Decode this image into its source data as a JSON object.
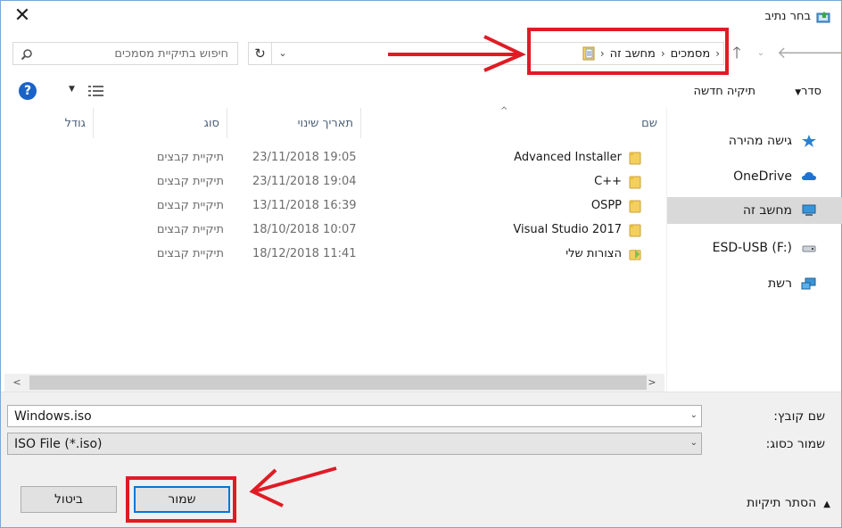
{
  "window": {
    "title": "בחר נתיב"
  },
  "address": {
    "crumbs": [
      "מחשב זה",
      "מסמכים"
    ]
  },
  "search": {
    "placeholder": "חיפוש בתיקיית מסמכים"
  },
  "toolbar": {
    "organize": "סדר",
    "new_folder": "תיקיה חדשה"
  },
  "navpane": {
    "items": [
      {
        "label": "גישה מהירה",
        "icon": "star-icon"
      },
      {
        "label": "OneDrive",
        "icon": "cloud-icon"
      },
      {
        "label": "מחשב זה",
        "icon": "computer-icon",
        "selected": true
      },
      {
        "label": "ESD-USB (F:)",
        "icon": "usb-drive-icon"
      },
      {
        "label": "רשת",
        "icon": "network-icon"
      }
    ]
  },
  "filelist": {
    "columns": {
      "name": "שם",
      "modified": "תאריך שינוי",
      "type": "סוג",
      "size": "גודל"
    },
    "rows": [
      {
        "name": "Advanced Installer",
        "modified": "23/11/2018 19:05",
        "type": "תיקיית קבצים"
      },
      {
        "name": "C++",
        "modified": "23/11/2018 19:04",
        "type": "תיקיית קבצים"
      },
      {
        "name": "OSPP",
        "modified": "13/11/2018 16:39",
        "type": "תיקיית קבצים"
      },
      {
        "name": "Visual Studio 2017",
        "modified": "18/10/2018 10:07",
        "type": "תיקיית קבצים"
      },
      {
        "name": "הצורות שלי",
        "modified": "18/12/2018 11:41",
        "type": "תיקיית קבצים"
      }
    ]
  },
  "form": {
    "filename_label": "שם קובץ:",
    "filename_value": "Windows.iso",
    "filetype_label": "שמור כסוג:",
    "filetype_value": "ISO File (*.iso)"
  },
  "buttons": {
    "save": "שמור",
    "cancel": "ביטול",
    "hide_folders": "הסתר תיקיות"
  },
  "colors": {
    "annotation": "#e01b24",
    "accent": "#0078d7",
    "selected_bg": "#d9d9d9"
  }
}
